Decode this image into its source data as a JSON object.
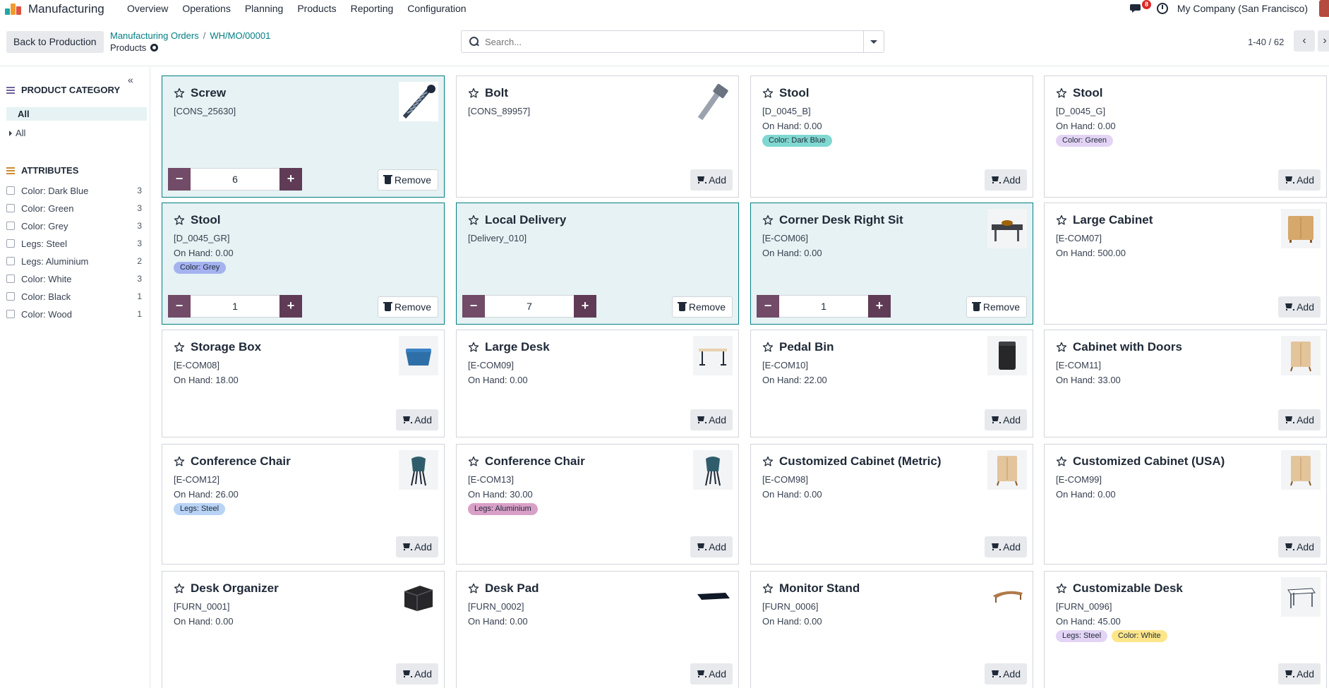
{
  "navbar": {
    "app_name": "Manufacturing",
    "menu": [
      "Overview",
      "Operations",
      "Planning",
      "Products",
      "Reporting",
      "Configuration"
    ],
    "messages_count": "8",
    "company": "My Company (San Francisco)"
  },
  "control": {
    "back_label": "Back to Production",
    "breadcrumb": [
      "Manufacturing Orders",
      "WH/MO/00001"
    ],
    "breadcrumb_sep": "/",
    "title": "Products",
    "search_placeholder": "Search...",
    "pager": "1-40 / 62",
    "prev": "‹",
    "next": "›"
  },
  "sidebar": {
    "collapse": "«",
    "category_title": "PRODUCT CATEGORY",
    "category_selected": "All",
    "category_child": "All",
    "attributes_title": "ATTRIBUTES",
    "attributes": [
      {
        "label": "Color: Dark Blue",
        "count": "3"
      },
      {
        "label": "Color: Green",
        "count": "3"
      },
      {
        "label": "Color: Grey",
        "count": "3"
      },
      {
        "label": "Legs: Steel",
        "count": "3"
      },
      {
        "label": "Legs: Aluminium",
        "count": "2"
      },
      {
        "label": "Color: White",
        "count": "3"
      },
      {
        "label": "Color: Black",
        "count": "1"
      },
      {
        "label": "Color: Wood",
        "count": "1"
      }
    ]
  },
  "labels": {
    "add": "Add",
    "remove": "Remove",
    "minus": "−",
    "plus": "+"
  },
  "products": [
    {
      "name": "Screw",
      "code": "[CONS_25630]",
      "on_hand": "",
      "tags": [],
      "selected": true,
      "qty": "6",
      "thumb": "screw"
    },
    {
      "name": "Bolt",
      "code": "[CONS_89957]",
      "on_hand": "",
      "tags": [],
      "selected": false,
      "thumb": "bolt"
    },
    {
      "name": "Stool",
      "code": "[D_0045_B]",
      "on_hand": "On Hand: 0.00",
      "tags": [
        {
          "text": "Color: Dark Blue",
          "color": "#7fd8d1"
        }
      ],
      "selected": false,
      "thumb": ""
    },
    {
      "name": "Stool",
      "code": "[D_0045_G]",
      "on_hand": "On Hand: 0.00",
      "tags": [
        {
          "text": "Color: Green",
          "color": "#e3d4f5"
        }
      ],
      "selected": false,
      "thumb": ""
    },
    {
      "name": "Stool",
      "code": "[D_0045_GR]",
      "on_hand": "On Hand: 0.00",
      "tags": [
        {
          "text": "Color: Grey",
          "color": "#a5b2f0"
        }
      ],
      "selected": true,
      "qty": "1",
      "thumb": ""
    },
    {
      "name": "Local Delivery",
      "code": "[Delivery_010]",
      "on_hand": "",
      "tags": [],
      "selected": true,
      "qty": "7",
      "thumb": ""
    },
    {
      "name": "Corner Desk Right Sit",
      "code": "[E-COM06]",
      "on_hand": "On Hand: 0.00",
      "tags": [],
      "selected": true,
      "qty": "1",
      "thumb": "corner-desk"
    },
    {
      "name": "Large Cabinet",
      "code": "[E-COM07]",
      "on_hand": "On Hand: 500.00",
      "tags": [],
      "selected": false,
      "thumb": "cabinet"
    },
    {
      "name": "Storage Box",
      "code": "[E-COM08]",
      "on_hand": "On Hand: 18.00",
      "tags": [],
      "selected": false,
      "thumb": "storage-box"
    },
    {
      "name": "Large Desk",
      "code": "[E-COM09]",
      "on_hand": "On Hand: 0.00",
      "tags": [],
      "selected": false,
      "thumb": "desk"
    },
    {
      "name": "Pedal Bin",
      "code": "[E-COM10]",
      "on_hand": "On Hand: 22.00",
      "tags": [],
      "selected": false,
      "thumb": "bin"
    },
    {
      "name": "Cabinet with Doors",
      "code": "[E-COM11]",
      "on_hand": "On Hand: 33.00",
      "tags": [],
      "selected": false,
      "thumb": "cabinet-doors"
    },
    {
      "name": "Conference Chair",
      "code": "[E-COM12]",
      "on_hand": "On Hand: 26.00",
      "tags": [
        {
          "text": "Legs: Steel",
          "color": "#b8d3f5"
        }
      ],
      "selected": false,
      "thumb": "chair"
    },
    {
      "name": "Conference Chair",
      "code": "[E-COM13]",
      "on_hand": "On Hand: 30.00",
      "tags": [
        {
          "text": "Legs: Aluminium",
          "color": "#d9a0c7"
        }
      ],
      "selected": false,
      "thumb": "chair"
    },
    {
      "name": "Customized Cabinet (Metric)",
      "code": "[E-COM98]",
      "on_hand": "On Hand: 0.00",
      "tags": [],
      "selected": false,
      "thumb": "cabinet-doors"
    },
    {
      "name": "Customized Cabinet (USA)",
      "code": "[E-COM99]",
      "on_hand": "On Hand: 0.00",
      "tags": [],
      "selected": false,
      "thumb": "cabinet-doors"
    },
    {
      "name": "Desk Organizer",
      "code": "[FURN_0001]",
      "on_hand": "On Hand: 0.00",
      "tags": [],
      "selected": false,
      "thumb": "organizer"
    },
    {
      "name": "Desk Pad",
      "code": "[FURN_0002]",
      "on_hand": "On Hand: 0.00",
      "tags": [],
      "selected": false,
      "thumb": "desk-pad"
    },
    {
      "name": "Monitor Stand",
      "code": "[FURN_0006]",
      "on_hand": "On Hand: 0.00",
      "tags": [],
      "selected": false,
      "thumb": "monitor-stand"
    },
    {
      "name": "Customizable Desk",
      "code": "[FURN_0096]",
      "on_hand": "On Hand: 45.00",
      "tags": [
        {
          "text": "Legs: Steel",
          "color": "#e3d4f5"
        },
        {
          "text": "Color: White",
          "color": "#fde68a"
        }
      ],
      "selected": false,
      "thumb": "custom-desk"
    }
  ]
}
